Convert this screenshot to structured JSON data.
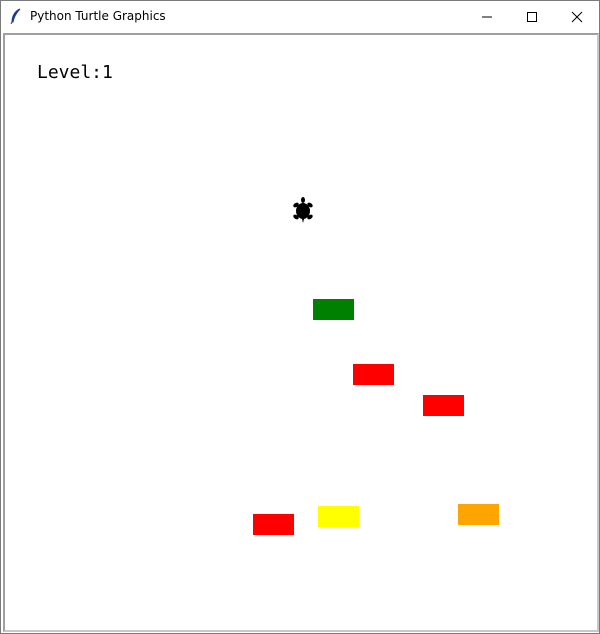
{
  "window": {
    "title": "Python Turtle Graphics",
    "icon": "feather-icon",
    "controls": [
      "minimize-icon",
      "maximize-icon",
      "close-icon"
    ]
  },
  "game": {
    "level_text": "Level:1",
    "player": {
      "icon": "turtle-icon",
      "color": "#000000"
    },
    "blocks": [
      {
        "color": "#008000"
      },
      {
        "color": "#ff0000"
      },
      {
        "color": "#ff0000"
      },
      {
        "color": "#ff0000"
      },
      {
        "color": "#ffff00"
      },
      {
        "color": "#ffa500"
      }
    ]
  }
}
